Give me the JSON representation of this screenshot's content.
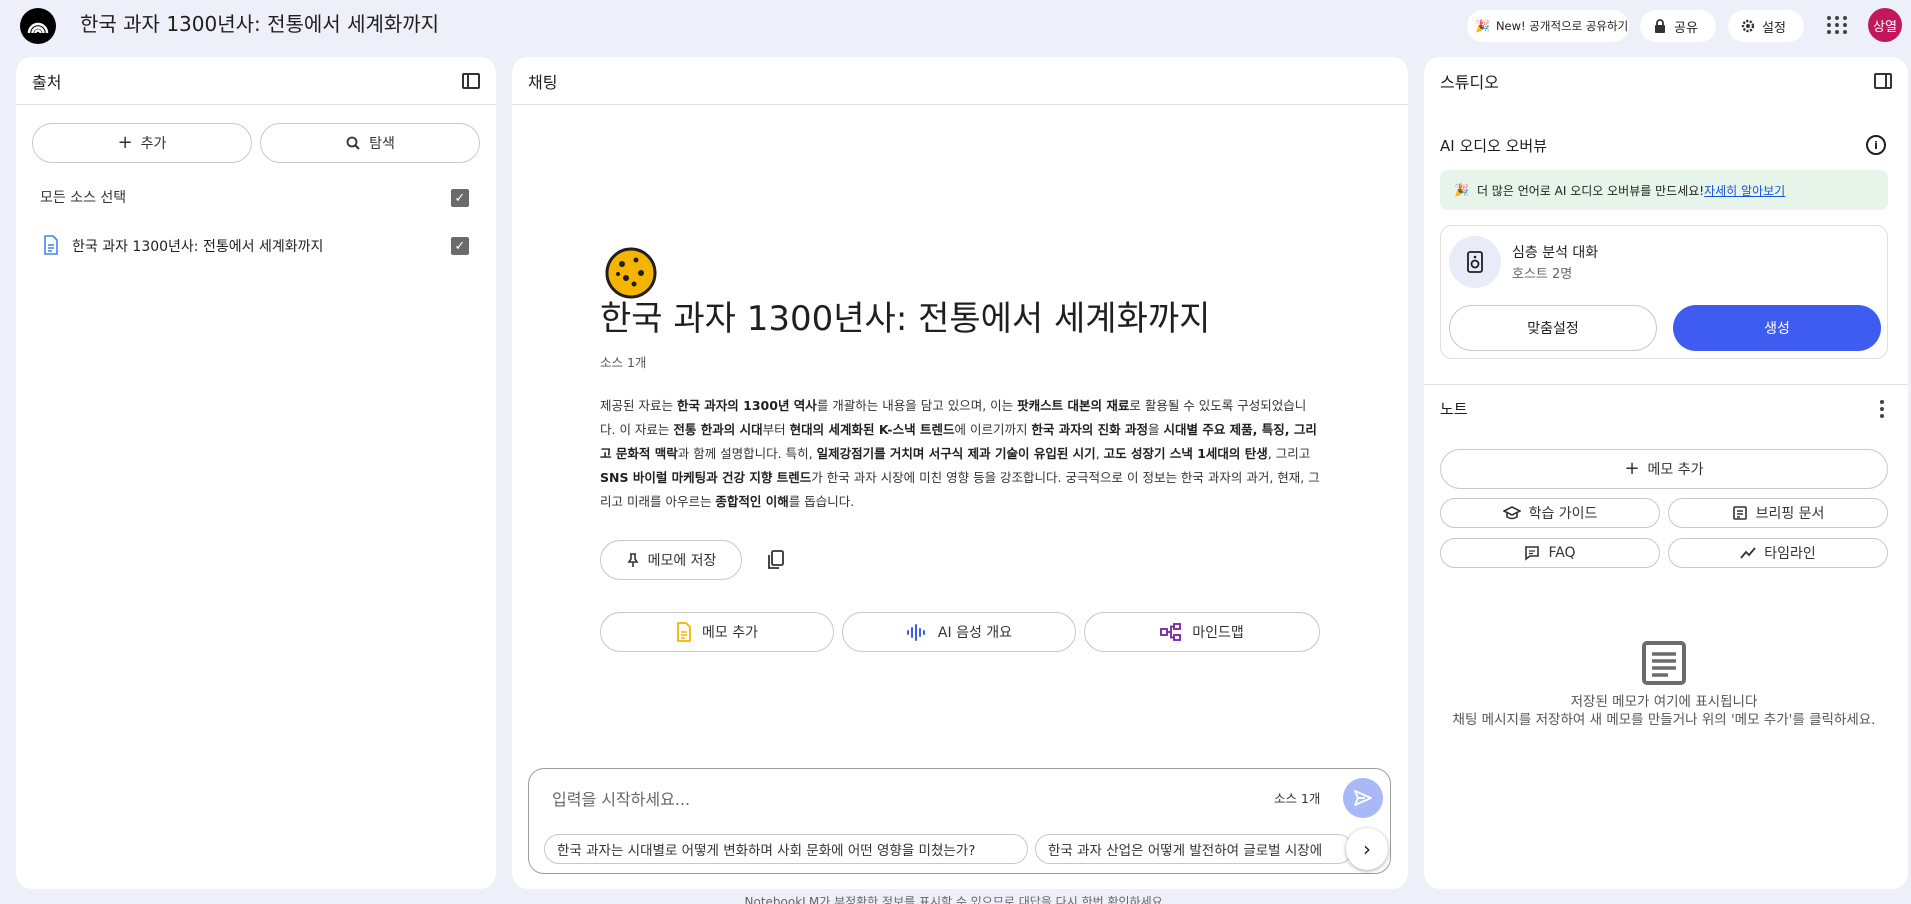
{
  "header": {
    "title": "한국 과자 1300년사: 전통에서 세계화까지",
    "share_public_label": "New! 공개적으로 공유하기",
    "share_label": "공유",
    "settings_label": "설정",
    "avatar_text": "상열"
  },
  "sources": {
    "title": "출처",
    "add_label": "추가",
    "explore_label": "탐색",
    "select_all_label": "모든 소스 선택",
    "items": [
      {
        "label": "한국 과자 1300년사: 전통에서 세계화까지"
      }
    ]
  },
  "chat": {
    "title": "채팅",
    "emoji": "🍪",
    "notebook_title": "한국 과자 1300년사: 전통에서 세계화까지",
    "source_count": "소스 1개",
    "save_note_label": "메모에 저장",
    "actions": [
      {
        "label": "메모 추가"
      },
      {
        "label": "AI 음성 개요"
      },
      {
        "label": "마인드맵"
      }
    ],
    "input_placeholder": "입력을 시작하세요...",
    "input_source_count": "소스 1개",
    "suggestions": [
      {
        "label": "한국 과자는 시대별로 어떻게 변화하며 사회 문화에 어떤 영향을 미쳤는가?"
      },
      {
        "label": "한국 과자 산업은 어떻게 발전하여 글로벌 시장에"
      }
    ],
    "disclaimer": "NotebookLM가 부정확한 정보를 표시할 수 있으므로 대답을 다시 한번 확인하세요."
  },
  "studio": {
    "title": "스튜디오",
    "audio_title": "AI 오디오 오버뷰",
    "banner_text": "더 많은 언어로 AI 오디오 오버뷰를 만드세요!",
    "banner_link": "자세히 알아보기",
    "deep_dive_title": "심층 분석 대화",
    "deep_dive_sub": "호스트 2명",
    "customize_label": "맞춤설정",
    "generate_label": "생성",
    "notes_title": "노트",
    "add_note_label": "메모 추가",
    "study_guide_label": "학습 가이드",
    "briefing_label": "브리핑 문서",
    "faq_label": "FAQ",
    "timeline_label": "타임라인",
    "empty_title": "저장된 메모가 여기에 표시됩니다",
    "empty_desc": "채팅 메시지를 저장하여 새 메모를 만들거나 위의 '메모 추가'를 클릭하세요."
  },
  "colors": {
    "primary": "#3f5cf1",
    "avatar": "#c2185b",
    "banner": "#e6f4ea",
    "background": "#eef0f9"
  }
}
